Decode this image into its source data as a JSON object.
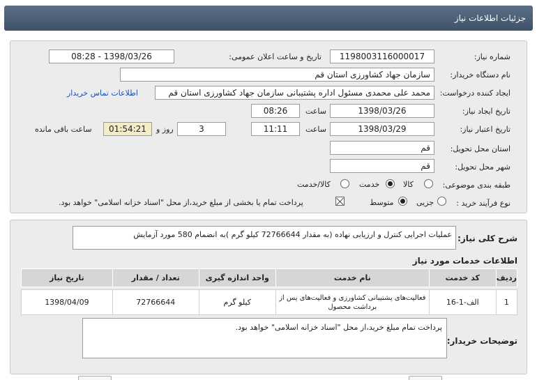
{
  "title": "جزئیات اطلاعات نیاز",
  "fields": {
    "need_number_label": "شماره نیاز:",
    "need_number": "1198003116000017",
    "announce_label": "تاریخ و ساعت اعلان عمومی:",
    "announce_value": "1398/03/26 - 08:28",
    "buyer_org_label": "نام دستگاه خریدار:",
    "buyer_org": "سازمان جهاد کشاورزی استان قم",
    "creator_label": "ایجاد کننده درخواست:",
    "creator": "محمد علی  محمدی  مسئول اداره پشتیبانی  سازمان جهاد کشاورزی استان قم",
    "contact_link": "اطلاعات تماس خریدار",
    "created_date_label": "تاریخ ایجاد نیاز:",
    "created_date": "1398/03/26",
    "time_label": "ساعت",
    "created_time": "08:26",
    "validity_label": "تاریخ اعتبار نیاز:",
    "validity_date": "1398/03/29",
    "validity_time": "11:11",
    "days_value": "3",
    "days_label": "روز و",
    "remaining_time": "01:54:21",
    "remaining_label": "ساعت باقی مانده",
    "province_label": "استان محل تحویل:",
    "province": "قم",
    "city_label": "شهر محل تحویل:",
    "city": "قم",
    "category_label": "طبقه بندی موضوعی:",
    "category_options": [
      "کالا",
      "خدمت",
      "کالا/خدمت"
    ],
    "category_selected": "خدمت",
    "process_label": "نوع فرآیند خرید :",
    "process_options": [
      "جزیی",
      "متوسط"
    ],
    "process_selected": "متوسط",
    "payment_note": "پرداخت تمام یا بخشی از مبلغ خرید،از محل \"اسناد خزانه اسلامی\" خواهد بود."
  },
  "description": {
    "label": "شرح کلی نیاز:",
    "text": "عملیات اجرایی کنترل و ارزیابی نهاده (به مقدار 72766644 کیلو گرم )به انضمام 580 مورد آزمایش"
  },
  "services": {
    "heading": "اطلاعات خدمات مورد نیاز",
    "columns": [
      "ردیف",
      "کد خدمت",
      "نام خدمت",
      "واحد اندازه گیری",
      "تعداد / مقدار",
      "تاریخ نیاز"
    ],
    "rows": [
      [
        "1",
        "الف-1-16",
        "فعالیت‌های پشتیبانی کشاورزی و فعالیت‌های پس از برداشت محصول",
        "کیلو گرم",
        "72766644",
        "1398/04/09"
      ]
    ]
  },
  "buyer_notes": {
    "label": "توضیحات خریدار:",
    "text": "پرداخت تمام  مبلغ خرید،از محل \"اسناد خزانه اسلامی\" خواهد بود."
  }
}
